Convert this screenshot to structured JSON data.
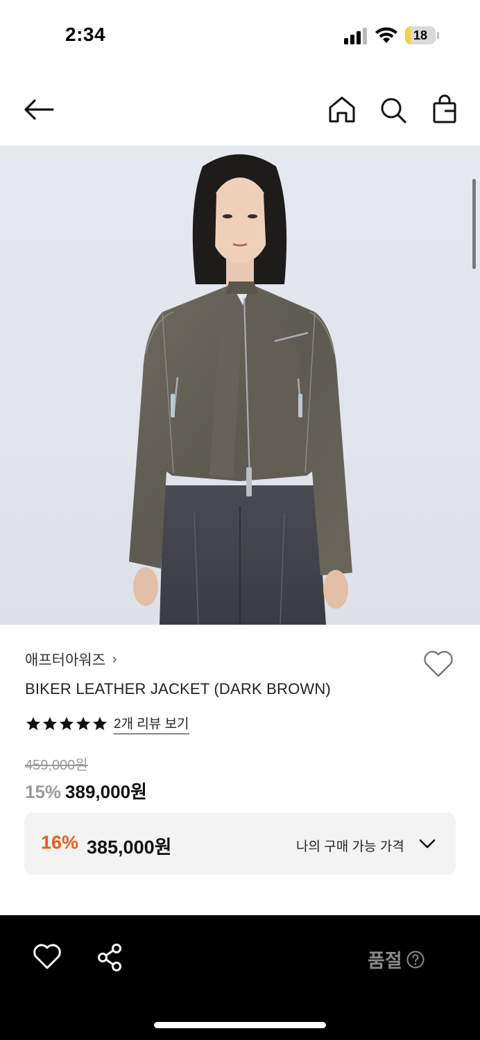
{
  "status_bar": {
    "time": "2:34",
    "battery_level": "18",
    "battery_fraction": 0.18,
    "battery_color": "#f4d33a"
  },
  "nav": {
    "back_icon": "arrow-left-icon",
    "home_icon": "home-icon",
    "search_icon": "search-icon",
    "bag_icon": "shopping-bag-icon"
  },
  "product": {
    "brand": "애프터아워즈",
    "brand_chevron": "›",
    "title": "BIKER LEATHER JACKET (DARK BROWN)",
    "rating_stars": 5,
    "review_link": "2개 리뷰 보기",
    "original_price": "459,000원",
    "discount_percent": "15%",
    "sale_price": "389,000원"
  },
  "my_price": {
    "percent": "16%",
    "price": "385,000원",
    "label": "나의 구매 가능 가격",
    "accent_color": "#f05a1a"
  },
  "bottom_bar": {
    "soldout_label": "품절",
    "wish_icon": "heart-icon",
    "share_icon": "share-icon",
    "help_icon": "help-circle-icon"
  }
}
